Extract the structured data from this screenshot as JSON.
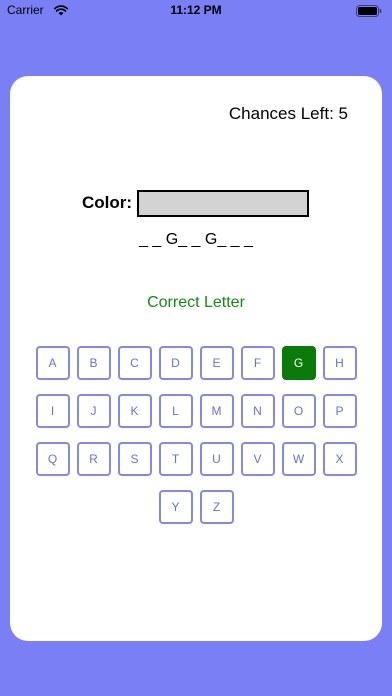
{
  "status_bar": {
    "carrier": "Carrier",
    "time": "11:12 PM"
  },
  "game": {
    "chances_label": "Chances Left:",
    "chances_value": "5",
    "category_label": "Color:",
    "category_box_color": "#d3d3d3",
    "word_display": "_ _ G_ _ G_ _ _",
    "feedback": "Correct Letter",
    "feedback_color": "#138a13"
  },
  "keyboard": {
    "accent_color": "#8589e6",
    "selected_color": "#0a7a0a",
    "rows": [
      [
        "A",
        "B",
        "C",
        "D",
        "E",
        "F",
        "G",
        "H"
      ],
      [
        "I",
        "J",
        "K",
        "L",
        "M",
        "N",
        "O",
        "P"
      ],
      [
        "Q",
        "R",
        "S",
        "T",
        "U",
        "V",
        "W",
        "X"
      ],
      [
        "Y",
        "Z"
      ]
    ],
    "guessed_correct": [
      "G"
    ]
  }
}
